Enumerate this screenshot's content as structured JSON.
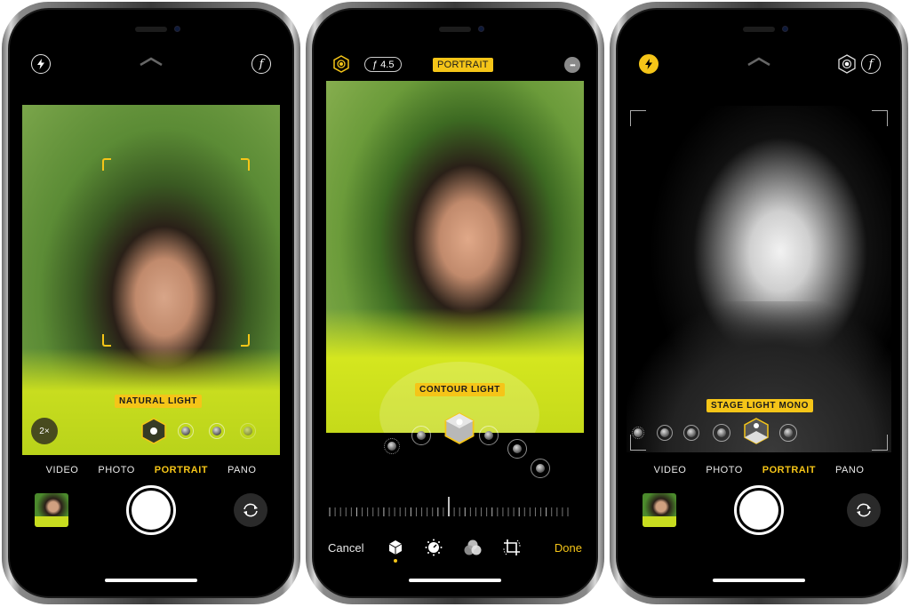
{
  "phones": [
    {
      "id": "natural-light-capture",
      "top_left_icon": "flash-icon",
      "top_right_icon": "aperture-f-icon",
      "top_right_label": "f",
      "lighting_label": "NATURAL LIGHT",
      "zoom_label": "2×",
      "modes": [
        "VIDEO",
        "PHOTO",
        "PORTRAIT",
        "PANO"
      ],
      "active_mode": "PORTRAIT"
    },
    {
      "id": "contour-light-edit",
      "top_left_icon": "depth-hexagon-icon",
      "aperture_label": "ƒ 4.5",
      "mode_badge": "PORTRAIT",
      "more_icon": "more-icon",
      "more_label": "•••",
      "lighting_label": "CONTOUR LIGHT",
      "slider_value_percent": 50,
      "cancel_label": "Cancel",
      "done_label": "Done",
      "toolbar_icons": [
        "portrait-lighting-cube-icon",
        "adjust-dial-icon",
        "filters-icon",
        "crop-rotate-icon"
      ]
    },
    {
      "id": "stage-light-mono-capture",
      "top_left_icon": "flash-icon",
      "top_right_icons": [
        "live-hexagon-icon",
        "aperture-f-icon"
      ],
      "top_right_label": "f",
      "lighting_label": "STAGE LIGHT MONO",
      "modes": [
        "VIDEO",
        "PHOTO",
        "PORTRAIT",
        "PANO"
      ],
      "active_mode": "PORTRAIT"
    }
  ],
  "colors": {
    "accent_yellow": "#f5c518",
    "background": "#000000",
    "text": "#eaeaea"
  }
}
